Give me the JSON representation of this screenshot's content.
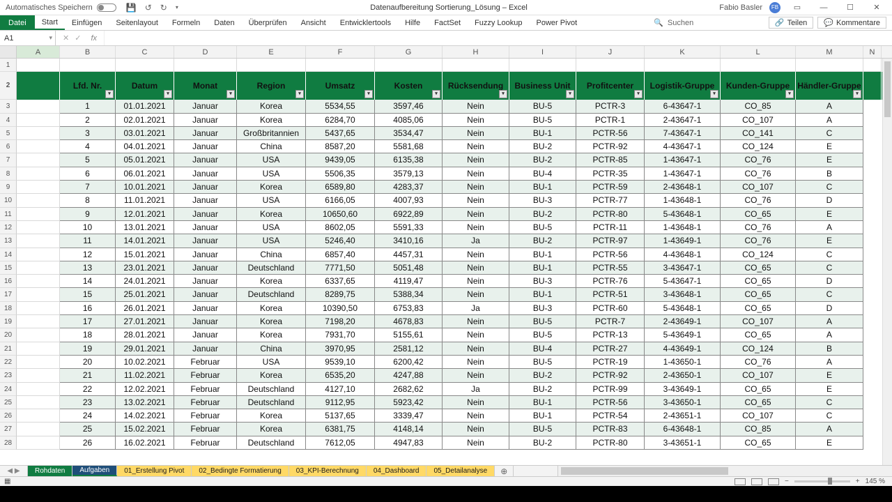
{
  "title": {
    "autosave": "Automatisches Speichern",
    "doc": "Datenaufbereitung Sortierung_Lösung – Excel",
    "user": "Fabio Basler",
    "avatar": "FB"
  },
  "ribbon": {
    "tabs": [
      "Datei",
      "Start",
      "Einfügen",
      "Seitenlayout",
      "Formeln",
      "Daten",
      "Überprüfen",
      "Ansicht",
      "Entwicklertools",
      "Hilfe",
      "FactSet",
      "Fuzzy Lookup",
      "Power Pivot"
    ],
    "search": "Suchen",
    "share": "Teilen",
    "comments": "Kommentare"
  },
  "namebox": "A1",
  "columns": [
    "A",
    "B",
    "C",
    "D",
    "E",
    "F",
    "G",
    "H",
    "I",
    "J",
    "K",
    "L",
    "M",
    "N"
  ],
  "headers": [
    "Lfd. Nr.",
    "Datum",
    "Monat",
    "Region",
    "Umsatz",
    "Kosten",
    "Rücksendung",
    "Business Unit",
    "Profitcenter",
    "Logistik-Gruppe",
    "Kunden-Gruppe",
    "Händler-Gruppe"
  ],
  "rows": [
    [
      "1",
      "01.01.2021",
      "Januar",
      "Korea",
      "5534,55",
      "3597,46",
      "Nein",
      "BU-5",
      "PCTR-3",
      "6-43647-1",
      "CO_85",
      "A"
    ],
    [
      "2",
      "02.01.2021",
      "Januar",
      "Korea",
      "6284,70",
      "4085,06",
      "Nein",
      "BU-5",
      "PCTR-1",
      "2-43647-1",
      "CO_107",
      "A"
    ],
    [
      "3",
      "03.01.2021",
      "Januar",
      "Großbritannien",
      "5437,65",
      "3534,47",
      "Nein",
      "BU-1",
      "PCTR-56",
      "7-43647-1",
      "CO_141",
      "C"
    ],
    [
      "4",
      "04.01.2021",
      "Januar",
      "China",
      "8587,20",
      "5581,68",
      "Nein",
      "BU-2",
      "PCTR-92",
      "4-43647-1",
      "CO_124",
      "E"
    ],
    [
      "5",
      "05.01.2021",
      "Januar",
      "USA",
      "9439,05",
      "6135,38",
      "Nein",
      "BU-2",
      "PCTR-85",
      "1-43647-1",
      "CO_76",
      "E"
    ],
    [
      "6",
      "06.01.2021",
      "Januar",
      "USA",
      "5506,35",
      "3579,13",
      "Nein",
      "BU-4",
      "PCTR-35",
      "1-43647-1",
      "CO_76",
      "B"
    ],
    [
      "7",
      "10.01.2021",
      "Januar",
      "Korea",
      "6589,80",
      "4283,37",
      "Nein",
      "BU-1",
      "PCTR-59",
      "2-43648-1",
      "CO_107",
      "C"
    ],
    [
      "8",
      "11.01.2021",
      "Januar",
      "USA",
      "6166,05",
      "4007,93",
      "Nein",
      "BU-3",
      "PCTR-77",
      "1-43648-1",
      "CO_76",
      "D"
    ],
    [
      "9",
      "12.01.2021",
      "Januar",
      "Korea",
      "10650,60",
      "6922,89",
      "Nein",
      "BU-2",
      "PCTR-80",
      "5-43648-1",
      "CO_65",
      "E"
    ],
    [
      "10",
      "13.01.2021",
      "Januar",
      "USA",
      "8602,05",
      "5591,33",
      "Nein",
      "BU-5",
      "PCTR-11",
      "1-43648-1",
      "CO_76",
      "A"
    ],
    [
      "11",
      "14.01.2021",
      "Januar",
      "USA",
      "5246,40",
      "3410,16",
      "Ja",
      "BU-2",
      "PCTR-97",
      "1-43649-1",
      "CO_76",
      "E"
    ],
    [
      "12",
      "15.01.2021",
      "Januar",
      "China",
      "6857,40",
      "4457,31",
      "Nein",
      "BU-1",
      "PCTR-56",
      "4-43648-1",
      "CO_124",
      "C"
    ],
    [
      "13",
      "23.01.2021",
      "Januar",
      "Deutschland",
      "7771,50",
      "5051,48",
      "Nein",
      "BU-1",
      "PCTR-55",
      "3-43647-1",
      "CO_65",
      "C"
    ],
    [
      "14",
      "24.01.2021",
      "Januar",
      "Korea",
      "6337,65",
      "4119,47",
      "Nein",
      "BU-3",
      "PCTR-76",
      "5-43647-1",
      "CO_65",
      "D"
    ],
    [
      "15",
      "25.01.2021",
      "Januar",
      "Deutschland",
      "8289,75",
      "5388,34",
      "Nein",
      "BU-1",
      "PCTR-51",
      "3-43648-1",
      "CO_65",
      "C"
    ],
    [
      "16",
      "26.01.2021",
      "Januar",
      "Korea",
      "10390,50",
      "6753,83",
      "Ja",
      "BU-3",
      "PCTR-60",
      "5-43648-1",
      "CO_65",
      "D"
    ],
    [
      "17",
      "27.01.2021",
      "Januar",
      "Korea",
      "7198,20",
      "4678,83",
      "Nein",
      "BU-5",
      "PCTR-7",
      "2-43649-1",
      "CO_107",
      "A"
    ],
    [
      "18",
      "28.01.2021",
      "Januar",
      "Korea",
      "7931,70",
      "5155,61",
      "Nein",
      "BU-5",
      "PCTR-13",
      "5-43649-1",
      "CO_65",
      "A"
    ],
    [
      "19",
      "29.01.2021",
      "Januar",
      "China",
      "3970,95",
      "2581,12",
      "Nein",
      "BU-4",
      "PCTR-27",
      "4-43649-1",
      "CO_124",
      "B"
    ],
    [
      "20",
      "10.02.2021",
      "Februar",
      "USA",
      "9539,10",
      "6200,42",
      "Nein",
      "BU-5",
      "PCTR-19",
      "1-43650-1",
      "CO_76",
      "A"
    ],
    [
      "21",
      "11.02.2021",
      "Februar",
      "Korea",
      "6535,20",
      "4247,88",
      "Nein",
      "BU-2",
      "PCTR-92",
      "2-43650-1",
      "CO_107",
      "E"
    ],
    [
      "22",
      "12.02.2021",
      "Februar",
      "Deutschland",
      "4127,10",
      "2682,62",
      "Ja",
      "BU-2",
      "PCTR-99",
      "3-43649-1",
      "CO_65",
      "E"
    ],
    [
      "23",
      "13.02.2021",
      "Februar",
      "Deutschland",
      "9112,95",
      "5923,42",
      "Nein",
      "BU-1",
      "PCTR-56",
      "3-43650-1",
      "CO_65",
      "C"
    ],
    [
      "24",
      "14.02.2021",
      "Februar",
      "Korea",
      "5137,65",
      "3339,47",
      "Nein",
      "BU-1",
      "PCTR-54",
      "2-43651-1",
      "CO_107",
      "C"
    ],
    [
      "25",
      "15.02.2021",
      "Februar",
      "Korea",
      "6381,75",
      "4148,14",
      "Nein",
      "BU-5",
      "PCTR-83",
      "6-43648-1",
      "CO_85",
      "A"
    ],
    [
      "26",
      "16.02.2021",
      "Februar",
      "Deutschland",
      "7612,05",
      "4947,83",
      "Nein",
      "BU-2",
      "PCTR-80",
      "3-43651-1",
      "CO_65",
      "E"
    ]
  ],
  "sheets": [
    {
      "name": "Rohdaten",
      "cls": "green"
    },
    {
      "name": "Aufgaben",
      "cls": "blue"
    },
    {
      "name": "01_Erstellung Pivot",
      "cls": "yellow"
    },
    {
      "name": "02_Bedingte Formatierung",
      "cls": "yellow"
    },
    {
      "name": "03_KPI-Berechnung",
      "cls": "yellow"
    },
    {
      "name": "04_Dashboard",
      "cls": "yellow"
    },
    {
      "name": "05_Detailanalyse",
      "cls": "yellow"
    }
  ],
  "status": {
    "zoom": "145 %"
  }
}
